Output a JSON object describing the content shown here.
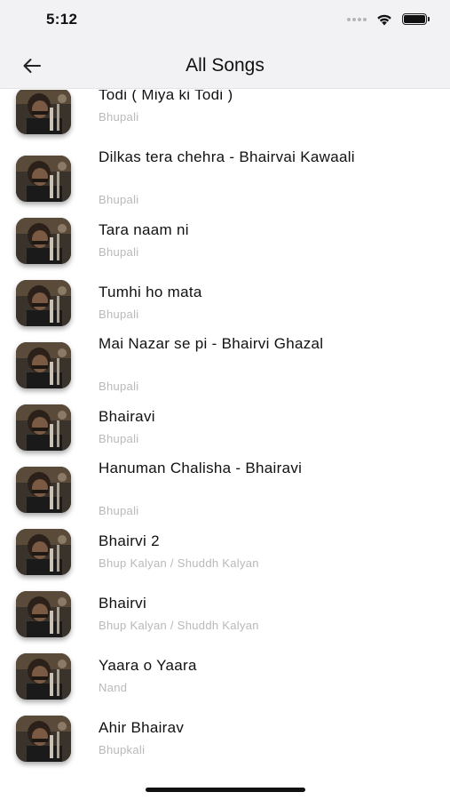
{
  "status_bar": {
    "time": "5:12"
  },
  "header": {
    "title": "All Songs",
    "back_icon": "arrow-left-icon"
  },
  "songs": [
    {
      "title": "Todi ( Miya ki Todi )",
      "subtitle": "Bhupali"
    },
    {
      "title": "Dilkas tera chehra - Bhairvai Kawaali",
      "subtitle": "Bhupali"
    },
    {
      "title": "Tara naam ni",
      "subtitle": "Bhupali"
    },
    {
      "title": "Tumhi ho mata",
      "subtitle": "Bhupali"
    },
    {
      "title": "Mai Nazar se pi - Bhairvi Ghazal",
      "subtitle": "Bhupali"
    },
    {
      "title": "Bhairavi",
      "subtitle": "Bhupali"
    },
    {
      "title": "Hanuman Chalisha - Bhairavi",
      "subtitle": "Bhupali"
    },
    {
      "title": "Bhairvi 2",
      "subtitle": "Bhup Kalyan / Shuddh Kalyan"
    },
    {
      "title": "Bhairvi",
      "subtitle": "Bhup Kalyan / Shuddh Kalyan"
    },
    {
      "title": "Yaara o Yaara",
      "subtitle": "Nand"
    },
    {
      "title": "Ahir Bhairav",
      "subtitle": "Bhupkali"
    }
  ]
}
